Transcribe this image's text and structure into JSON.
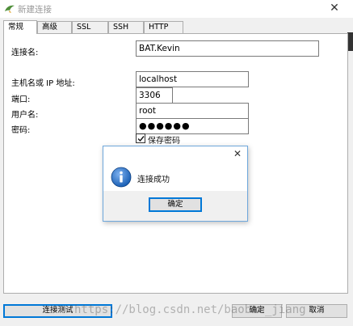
{
  "window": {
    "title": "新建连接",
    "icon": "dolphin-icon"
  },
  "tabs": [
    {
      "label": "常规",
      "active": true
    },
    {
      "label": "高级"
    },
    {
      "label": "SSL"
    },
    {
      "label": "SSH"
    },
    {
      "label": "HTTP"
    }
  ],
  "form": {
    "connection_name_label": "连接名:",
    "connection_name_value": "BAT.Kevin",
    "host_label": "主机名或 IP 地址:",
    "host_value": "localhost",
    "port_label": "端口:",
    "port_value": "3306",
    "user_label": "用户名:",
    "user_value": "root",
    "password_label": "密码:",
    "password_value": "●●●●●●",
    "save_password_label": "保存密码",
    "save_password_checked": true
  },
  "message_box": {
    "icon": "info-icon",
    "text": "连接成功",
    "ok_label": "确定"
  },
  "footer": {
    "test_label": "连接测试",
    "ok_label": "确定",
    "cancel_label": "取消"
  },
  "watermark": "https://blog.csdn.net/baobao_jiang",
  "colors": {
    "accent": "#0078d7",
    "info_blue": "#1a5fb4"
  }
}
